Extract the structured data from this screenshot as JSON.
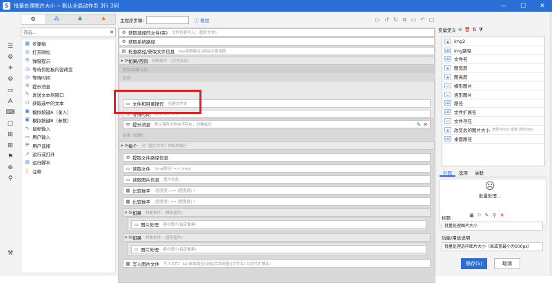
{
  "window": {
    "title": "批量处理图片大小 -- 默认全局动作页 3行 3列",
    "minimize": "—",
    "maximize": "☐",
    "close": "✕"
  },
  "palette": {
    "categories": [
      "⚙",
      "⁂",
      "♣",
      "♠"
    ],
    "search_placeholder": "筛选...",
    "items": [
      {
        "label": "步骤组",
        "icon": "▦"
      },
      {
        "label": "打开网址",
        "icon": "◎"
      },
      {
        "label": "弹窗提示",
        "icon": "✉"
      },
      {
        "label": "等待剪贴板内容改变",
        "icon": "◷"
      },
      {
        "label": "等待时间",
        "icon": "◷"
      },
      {
        "label": "提示消息",
        "icon": "✉"
      },
      {
        "label": "发送文本到窗口",
        "icon": "✎"
      },
      {
        "label": "获取选中的文本",
        "icon": "☐"
      },
      {
        "label": "模拟按键A（录入）",
        "icon": "▣"
      },
      {
        "label": "模拟按键B（参数）",
        "icon": "▣"
      },
      {
        "label": "鼠标输入",
        "icon": "↖"
      },
      {
        "label": "用户输入",
        "icon": "▭"
      },
      {
        "label": "用户选择",
        "icon": "☰"
      },
      {
        "label": "运行或打开",
        "icon": "↗"
      },
      {
        "label": "运行脚本",
        "icon": "▤"
      },
      {
        "label": "注释",
        "icon": "▯"
      }
    ]
  },
  "toolbar": {
    "steps_label": "主程序步骤:",
    "steps_value": "",
    "help": "ⓘ 教程",
    "tools": [
      "▷",
      "↺",
      "↻",
      "⧉",
      "▭",
      "↶",
      "▢"
    ]
  },
  "flow": {
    "steps": [
      {
        "label": "获取选择的文件(夹)",
        "desc": "文件列表写入：(图片文件)",
        "icon": "⚙"
      },
      {
        "label": "获取系统路径",
        "desc": "",
        "icon": "⚙"
      },
      {
        "label": "检查路径/获取文件信息",
        "desc": "$$(桌面路径)\\网站文章用图",
        "icon": "▤"
      },
      {
        "label": "如果/否则",
        "desc": "判断条件：(文件存在)",
        "icon": "▾ ⟳"
      },
      {
        "label": "文件和目录操作",
        "desc": "创建文件夹",
        "icon": "▭"
      },
      {
        "label": "等待时间",
        "desc": "等待 100 ms",
        "icon": "◷"
      },
      {
        "label": "提示消息",
        "desc": "默认保存文件夹不存在，创建成功",
        "icon": "✉"
      },
      {
        "label": "每个",
        "desc": "对（图片文件）的每项执行",
        "icon": "▾ ⟳"
      },
      {
        "label": "提取文件路径信息",
        "desc": "",
        "icon": "⚙"
      },
      {
        "label": "读取文件",
        "desc": "(img路径) => (img)",
        "icon": "▭"
      },
      {
        "label": "读取图片信息",
        "desc": "图片信息",
        "icon": "▭"
      },
      {
        "label": "比较数字",
        "desc": "(图宽度) >= (图宽度) ?",
        "icon": "▦"
      },
      {
        "label": "比较数字",
        "desc": "(图宽度) <= (图宽度) ?",
        "icon": "▦"
      },
      {
        "label": "如果",
        "desc": "判断条件：(横形图片)",
        "icon": "▾ ⟳"
      },
      {
        "label": "图片处理",
        "desc": "缩小图片(指定像素)",
        "icon": "▭"
      },
      {
        "label": "如果",
        "desc": "判断条件：(竖形图片)",
        "icon": "▾ ⟳"
      },
      {
        "label": "图片处理",
        "desc": "缩小图片(指定像素)",
        "icon": "▭"
      },
      {
        "label": "写入图片文件",
        "desc": "写入文件：$$(桌面路径)\\网站文章用图\\(文件名)-1(文件扩展名)",
        "icon": "▦"
      }
    ],
    "group_labels": {
      "then": "然后(如果为真)",
      "else": "否则",
      "end": "结束（如果）"
    },
    "edit_icon": "✎",
    "delete_icon": "✕"
  },
  "variables": {
    "header": "变量定义",
    "icons": [
      "⊕",
      "🗑",
      "⇅",
      "⧩"
    ],
    "items": [
      {
        "name": "img2",
        "type": "▣"
      },
      {
        "name": "img路径",
        "type": "ABC"
      },
      {
        "name": "文件名",
        "type": "ABC"
      },
      {
        "name": "图宽度",
        "type": "▦"
      },
      {
        "name": "图高度",
        "type": "▦"
      },
      {
        "name": "横形图片",
        "type": "☑"
      },
      {
        "name": "竖形图片",
        "type": "☑"
      },
      {
        "name": "路径",
        "type": "ABC"
      },
      {
        "name": "文件扩展名",
        "type": "ABC"
      },
      {
        "name": "文件存在",
        "type": "☑"
      },
      {
        "name": "改变后的图片大小",
        "type": "▦",
        "desc": "宽最500px 或者 高500px"
      },
      {
        "name": "桌面路径",
        "type": "ABC"
      }
    ]
  },
  "props": {
    "tabs": [
      "外观",
      "选项",
      "关联"
    ],
    "preview_name": "批量处理...",
    "preview_icon": "☹",
    "tool_icons": [
      "▣",
      "⚐",
      "✎",
      "⚲",
      "✕"
    ],
    "title_label": "标题",
    "title_value": "批量处理图片大小",
    "desc_label": "功能/用途说明",
    "desc_value": "批量处理选中图片大小（高或宽最小为500px）",
    "save": "保存(S)",
    "cancel": "取消"
  },
  "toolstrip": [
    "☰",
    "⚙",
    "☀",
    "⚙",
    "▭",
    "A",
    "⌨",
    "▢",
    "⊞",
    "⊞",
    "⚑",
    "⊕",
    "⚲"
  ]
}
